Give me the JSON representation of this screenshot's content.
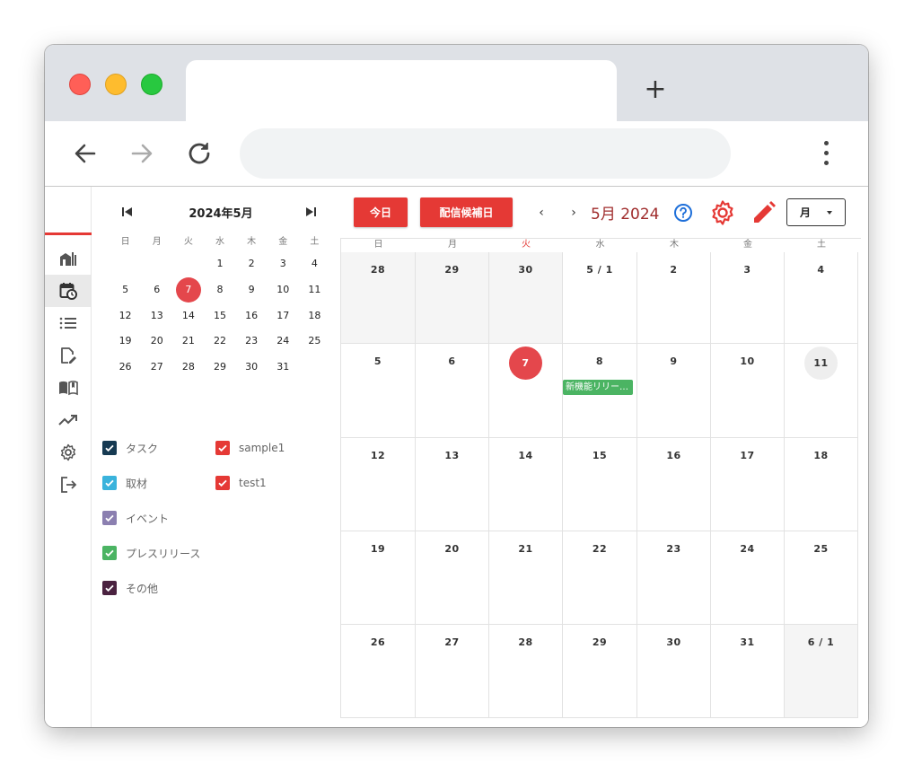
{
  "browser": {
    "tab_title": "",
    "address": ""
  },
  "sidebar": {
    "items": [
      {
        "name": "dashboard",
        "icon": "building-chart-icon"
      },
      {
        "name": "calendar",
        "icon": "calendar-clock-icon",
        "active": true
      },
      {
        "name": "list",
        "icon": "list-icon"
      },
      {
        "name": "edit-document",
        "icon": "document-edit-icon"
      },
      {
        "name": "guide",
        "icon": "open-book-icon"
      },
      {
        "name": "analytics",
        "icon": "trending-up-icon"
      },
      {
        "name": "settings",
        "icon": "gear-icon"
      },
      {
        "name": "logout",
        "icon": "logout-icon"
      }
    ],
    "accent_color": "#e53935"
  },
  "mini_calendar": {
    "title": "2024年5月",
    "weekdays": [
      "日",
      "月",
      "火",
      "水",
      "木",
      "金",
      "土"
    ],
    "weeks": [
      [
        "",
        "",
        "",
        "1",
        "2",
        "3",
        "4"
      ],
      [
        "5",
        "6",
        "7",
        "8",
        "9",
        "10",
        "11"
      ],
      [
        "12",
        "13",
        "14",
        "15",
        "16",
        "17",
        "18"
      ],
      [
        "19",
        "20",
        "21",
        "22",
        "23",
        "24",
        "25"
      ],
      [
        "26",
        "27",
        "28",
        "29",
        "30",
        "31",
        ""
      ]
    ],
    "today": "7"
  },
  "filters": [
    {
      "label": "タスク",
      "color": "#163a52",
      "checked": true
    },
    {
      "label": "sample1",
      "color": "#e53935",
      "checked": true
    },
    {
      "label": "取材",
      "color": "#3ab3dc",
      "checked": true
    },
    {
      "label": "test1",
      "color": "#e53935",
      "checked": true
    },
    {
      "label": "イベント",
      "color": "#8b7fb0",
      "checked": true
    },
    {
      "label": "プレスリリース",
      "color": "#4bb463",
      "checked": true
    },
    {
      "label": "その他",
      "color": "#4a2240",
      "checked": true
    }
  ],
  "toolbar": {
    "today_label": "今日",
    "candidate_label": "配信候補日",
    "month_label": "5月 2024",
    "view_label": "月",
    "help_icon": "help-circle-icon",
    "settings_icon": "gear-icon",
    "edit_icon": "pencil-icon"
  },
  "calendar": {
    "weekdays": [
      "日",
      "月",
      "火",
      "水",
      "木",
      "金",
      "土"
    ],
    "weeks": [
      [
        "28",
        "29",
        "30",
        "5 / 1",
        "2",
        "3",
        "4"
      ],
      [
        "5",
        "6",
        "7",
        "8",
        "9",
        "10",
        "11"
      ],
      [
        "12",
        "13",
        "14",
        "15",
        "16",
        "17",
        "18"
      ],
      [
        "19",
        "20",
        "21",
        "22",
        "23",
        "24",
        "25"
      ],
      [
        "26",
        "27",
        "28",
        "29",
        "30",
        "31",
        "6 / 1"
      ]
    ],
    "today": "7",
    "events": [
      {
        "date": "8",
        "label": "新機能リリー…",
        "color": "#4bb463"
      }
    ]
  }
}
